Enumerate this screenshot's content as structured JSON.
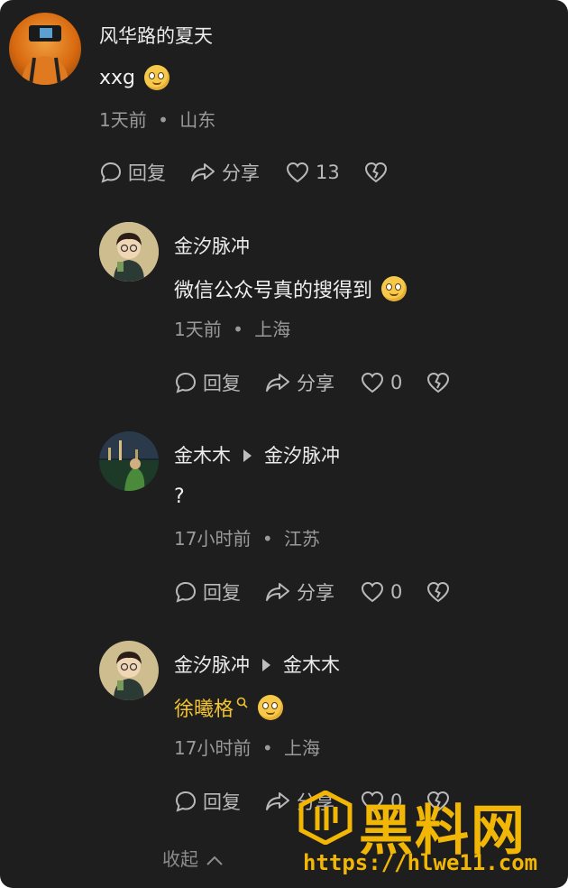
{
  "comments": [
    {
      "name": "风华路的夏天",
      "reply_to": "",
      "text": "xxg",
      "time": "1天前",
      "location": "山东",
      "reply_label": "回复",
      "share_label": "分享",
      "likes": "13"
    },
    {
      "name": "金汐脉冲",
      "reply_to": "",
      "text": "微信公众号真的搜得到",
      "time": "1天前",
      "location": "上海",
      "reply_label": "回复",
      "share_label": "分享",
      "likes": "0"
    },
    {
      "name": "金木木",
      "reply_to": "金汐脉冲",
      "text": "?",
      "time": "17小时前",
      "location": "江苏",
      "reply_label": "回复",
      "share_label": "分享",
      "likes": "0"
    },
    {
      "name": "金汐脉冲",
      "reply_to": "金木木",
      "text": "徐曦格",
      "time": "17小时前",
      "location": "上海",
      "reply_label": "回复",
      "share_label": "分享",
      "likes": "0"
    }
  ],
  "meta_separator": "•",
  "collapse_label": "收起",
  "watermark": {
    "title": "黑料网",
    "url": "https://hlwe11.com"
  },
  "colors": {
    "background": "#1e1e1e",
    "link": "#f1c232",
    "watermark": "#f2b705"
  },
  "icons": [
    "comment-icon",
    "share-icon",
    "heart-icon",
    "broken-heart-icon",
    "search-small-icon",
    "chevron-up-icon"
  ]
}
